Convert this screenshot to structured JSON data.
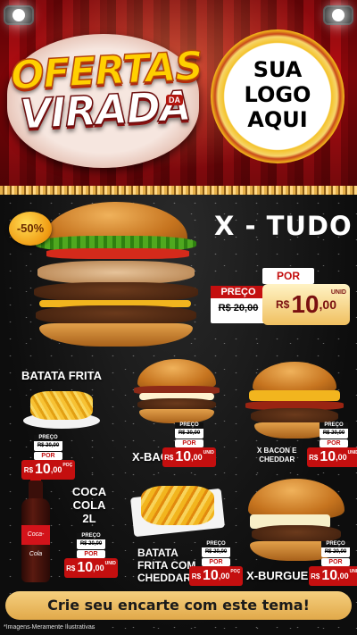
{
  "header": {
    "promo_word1": "OFERTAS",
    "promo_word2": "VIRADA",
    "promo_small": "DA",
    "logo_text_line1": "SUA",
    "logo_text_line2": "LOGO",
    "logo_text_line3": "AQUI"
  },
  "hero": {
    "title": "X - TUDO",
    "discount": "-50%",
    "preco_label": "PREÇO",
    "old_price": "R$ 20,00",
    "por_label": "POR",
    "currency": "R$",
    "price_int": "10",
    "price_dec": ",00",
    "unit": "UNID"
  },
  "items": [
    {
      "title": "BATATA FRITA",
      "preco_label": "PREÇO",
      "old_price": "R$ 20,00",
      "por_label": "POR",
      "currency": "R$",
      "price_int": "10",
      "price_dec": ",00",
      "unit": "POÇ"
    },
    {
      "title": "X-BACON",
      "preco_label": "PREÇO",
      "old_price": "R$ 20,00",
      "por_label": "POR",
      "currency": "R$",
      "price_int": "10",
      "price_dec": ",00",
      "unit": "UNID"
    },
    {
      "title_line1": "X BACON E",
      "title_line2": "CHEDDAR",
      "preco_label": "PREÇO",
      "old_price": "R$ 20,00",
      "por_label": "POR",
      "currency": "R$",
      "price_int": "10",
      "price_dec": ",00",
      "unit": "UNID"
    },
    {
      "title_line1": "COCA",
      "title_line2": "COLA",
      "title_line3": "2L",
      "preco_label": "PREÇO",
      "old_price": "R$ 20,00",
      "por_label": "POR",
      "currency": "R$",
      "price_int": "10",
      "price_dec": ",00",
      "unit": "UNID"
    },
    {
      "title_line1": "BATATA",
      "title_line2": "FRITA COM",
      "title_line3": "CHEDDAR",
      "preco_label": "PREÇO",
      "old_price": "R$ 20,00",
      "por_label": "POR",
      "currency": "R$",
      "price_int": "10",
      "price_dec": ",00",
      "unit": "POÇ"
    },
    {
      "title": "X-BURGUER",
      "preco_label": "PREÇO",
      "old_price": "R$ 20,00",
      "por_label": "POR",
      "currency": "R$",
      "price_int": "10",
      "price_dec": ",00",
      "unit": "UNID"
    }
  ],
  "footer": {
    "cta": "Crie seu encarte com este tema!",
    "note": "*Imagens Meramente Ilustrativas"
  },
  "colors": {
    "price_red": "#c40f0f",
    "gold": "#f0c060",
    "curtain_red": "#b30d12"
  },
  "icons": {
    "bottle": "coca-cola-bottle-icon",
    "fries": "fries-icon",
    "burger": "burger-icon"
  }
}
